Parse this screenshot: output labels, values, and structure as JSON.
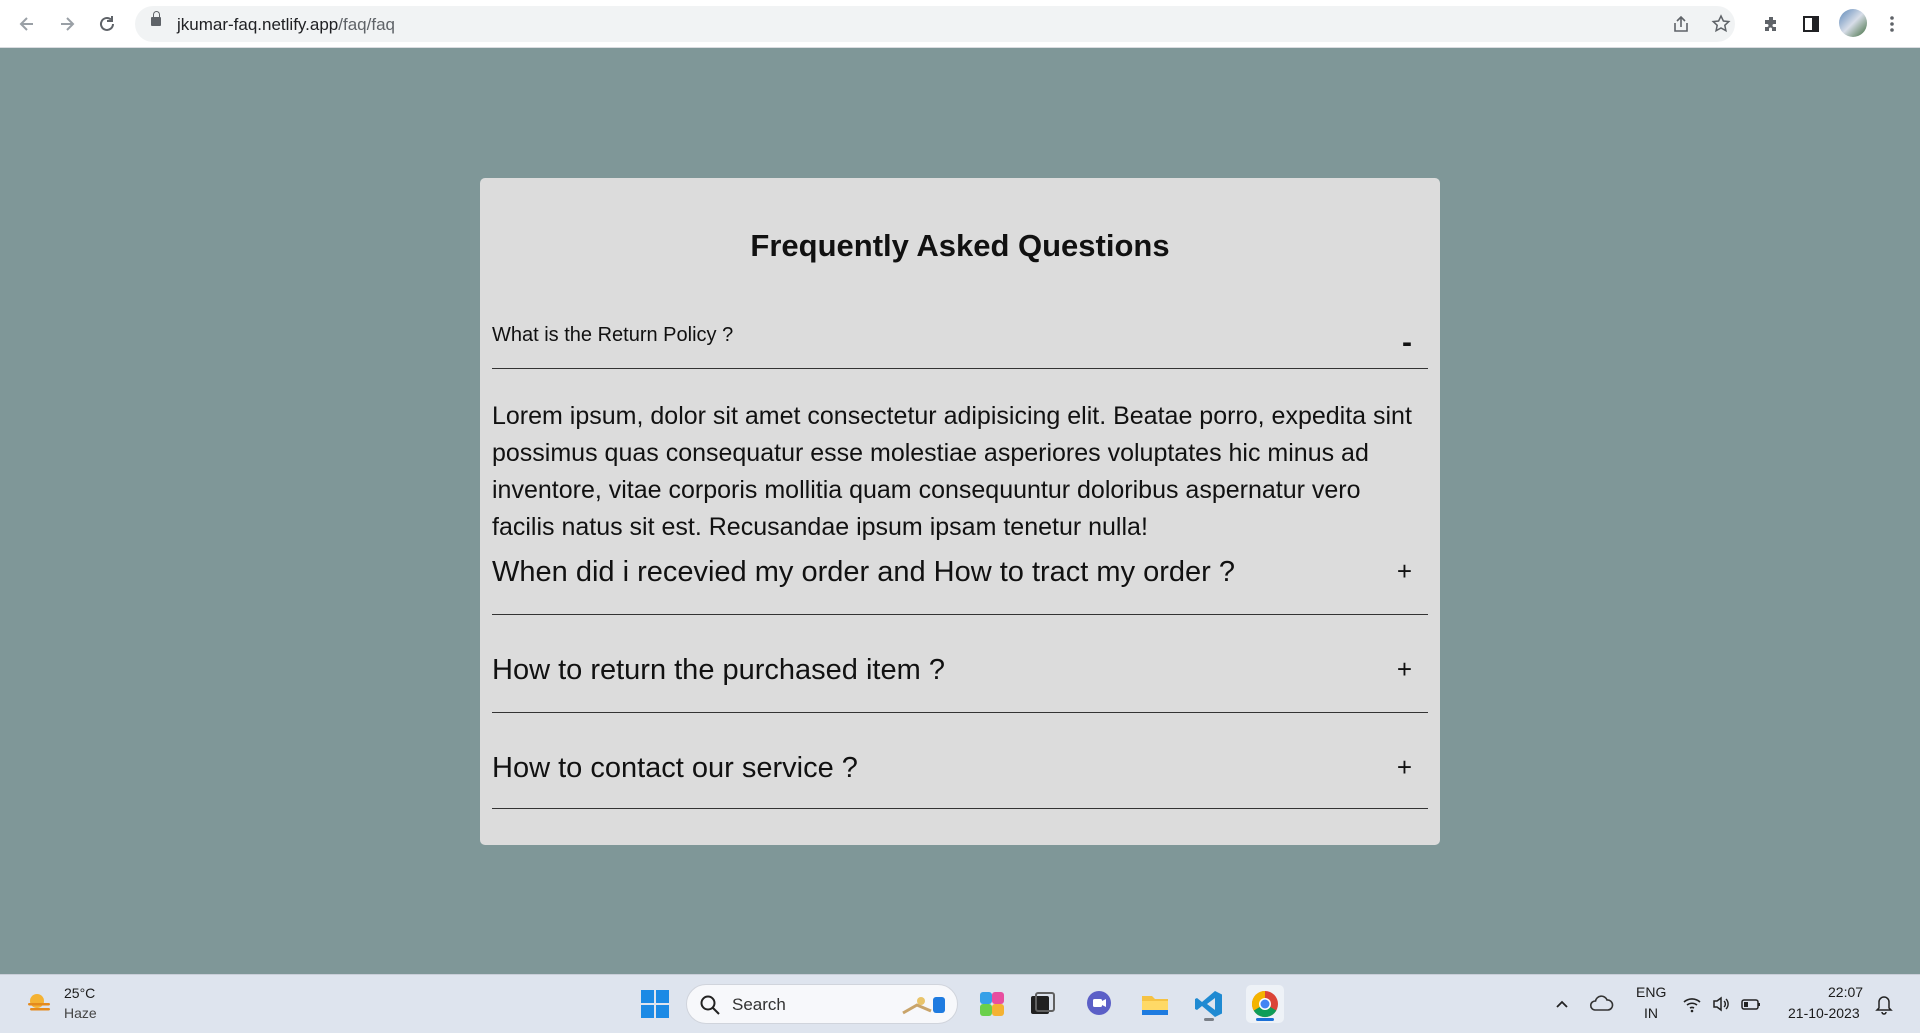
{
  "browser": {
    "url_host": "jkumar-faq.netlify.app",
    "url_path": "/faq/faq"
  },
  "faq": {
    "title": "Frequently Asked Questions",
    "items": [
      {
        "question": "What is the Return Policy ?",
        "toggle": "-",
        "expanded": true,
        "answer": "Lorem ipsum, dolor sit amet consectetur adipisicing elit. Beatae porro, expedita sint possimus quas consequatur esse molestiae asperiores voluptates hic minus ad inventore, vitae corporis mollitia quam consequuntur doloribus aspernatur vero facilis natus sit est. Recusandae ipsum ipsam tenetur nulla!"
      },
      {
        "question": "When did i recevied my order and How to tract my order ?",
        "toggle": "+",
        "expanded": false
      },
      {
        "question": "How to return the purchased item ?",
        "toggle": "+",
        "expanded": false
      },
      {
        "question": "How to contact our service ?",
        "toggle": "+",
        "expanded": false
      }
    ]
  },
  "taskbar": {
    "weather_temp": "25°C",
    "weather_desc": "Haze",
    "search_placeholder": "Search",
    "lang_top": "ENG",
    "lang_bottom": "IN",
    "time": "22:07",
    "date": "21-10-2023"
  },
  "colors": {
    "page_bg": "#7f9798",
    "card_bg": "#dcdcdc"
  }
}
